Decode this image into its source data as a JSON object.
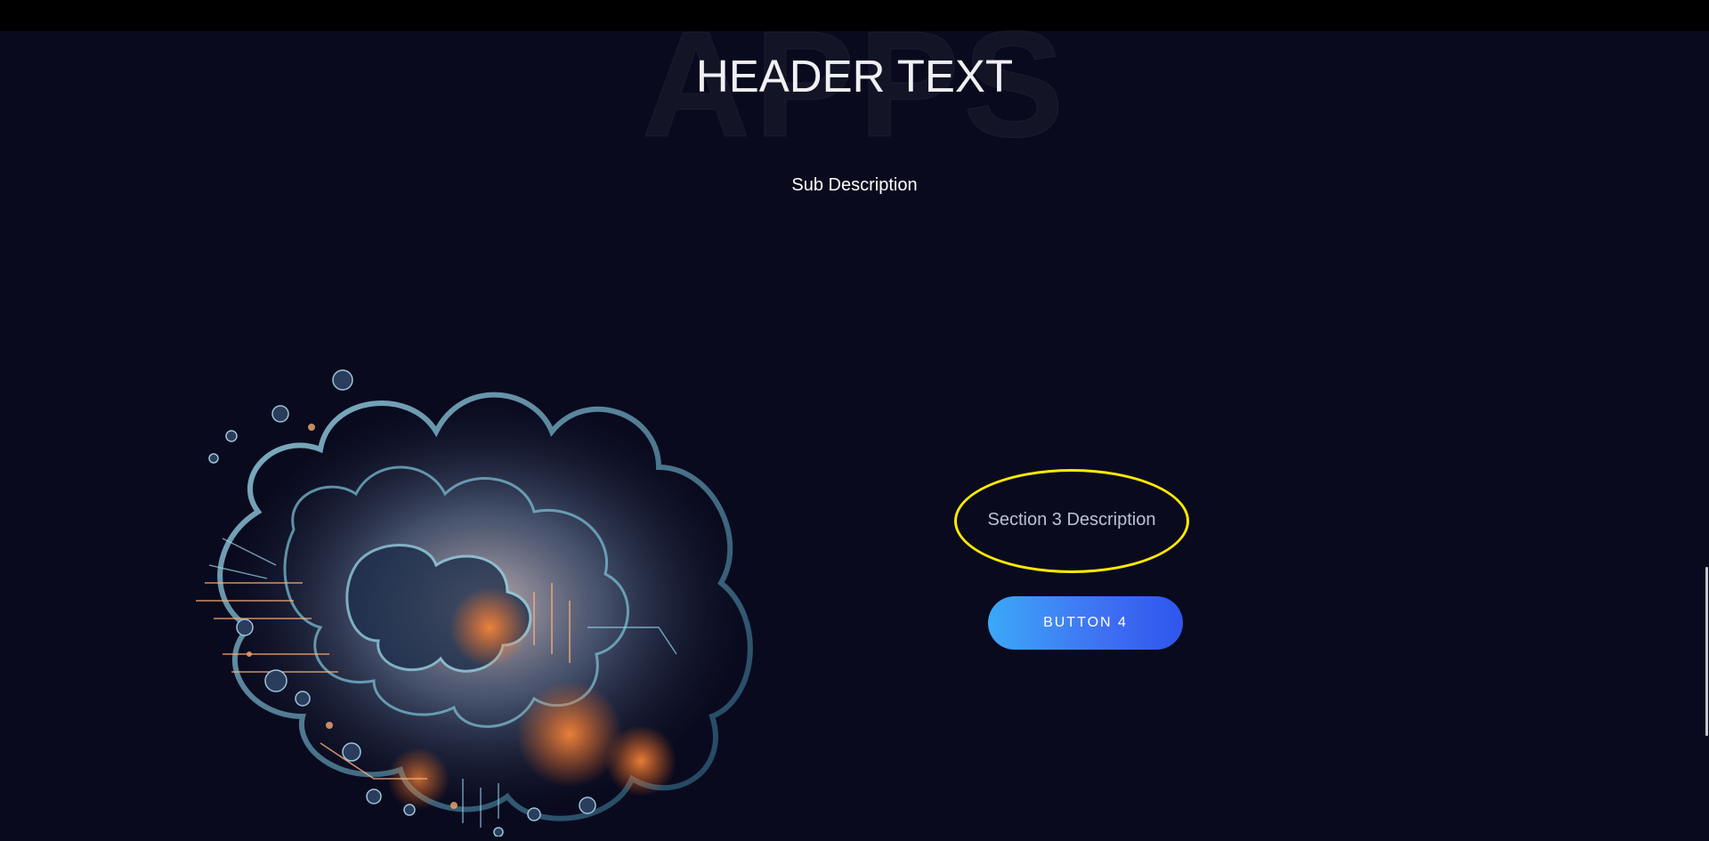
{
  "background_word": "APPS",
  "header": {
    "title": "HEADER TEXT",
    "subtitle": "Sub Description"
  },
  "section3": {
    "description": "Section 3 Description",
    "button_label": "BUTTON 4",
    "highlight_color": "#ffea00"
  },
  "colors": {
    "page_bg": "#0a0a1e",
    "button_gradient_start": "#3ca8f8",
    "button_gradient_end": "#2f55ee"
  },
  "images": {
    "hero": "brain-cloud-illustration"
  }
}
